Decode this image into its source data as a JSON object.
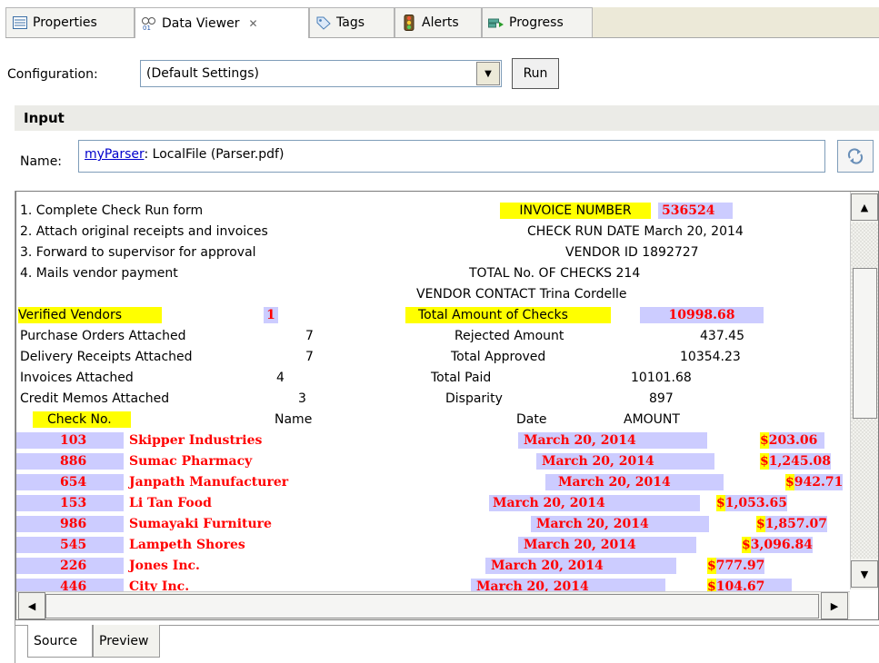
{
  "tabs": [
    {
      "label": "Properties",
      "icon": "properties-icon"
    },
    {
      "label": "Data Viewer",
      "icon": "data-viewer-icon",
      "active": true,
      "close": "✕"
    },
    {
      "label": "Tags",
      "icon": "tag-icon"
    },
    {
      "label": "Alerts",
      "icon": "alerts-icon"
    },
    {
      "label": "Progress",
      "icon": "progress-icon"
    }
  ],
  "config": {
    "label": "Configuration:",
    "value": "(Default Settings)",
    "run_label": "Run"
  },
  "input": {
    "header": "Input",
    "name_label": "Name:",
    "link": "myParser",
    "source": ": LocalFile (Parser.pdf)"
  },
  "document": {
    "instructions": [
      "1. Complete Check Run form",
      "2. Attach original receipts and invoices",
      "3. Forward to supervisor for approval",
      "4. Mails vendor payment"
    ],
    "invoice_number_label": "INVOICE NUMBER",
    "invoice_number": "536524",
    "check_run_date": "CHECK RUN DATE  March 20, 2014",
    "vendor_id": "VENDOR ID 1892727",
    "total_checks": "TOTAL No. OF CHECKS  214",
    "vendor_contact": "VENDOR CONTACT  Trina Cordelle",
    "left_stats": [
      {
        "label": "Verified Vendors",
        "value": "1"
      },
      {
        "label": "Purchase Orders Attached",
        "value": "7"
      },
      {
        "label": "Delivery Receipts Attached",
        "value": "7"
      },
      {
        "label": "Invoices Attached",
        "value": "4"
      },
      {
        "label": "Credit Memos Attached",
        "value": "3"
      }
    ],
    "right_stats": [
      {
        "label": "Total Amount of Checks",
        "value": "10998.68"
      },
      {
        "label": "Rejected Amount",
        "value": "437.45"
      },
      {
        "label": "Total Approved",
        "value": "10354.23"
      },
      {
        "label": "Total Paid",
        "value": "10101.68"
      },
      {
        "label": "Disparity",
        "value": "897"
      }
    ],
    "table_headers": {
      "check_no": "Check No.",
      "name": "Name",
      "date": "Date",
      "amount": "AMOUNT"
    },
    "rows": [
      {
        "check_no": "103",
        "name": "Skipper Industries",
        "date": "March 20, 2014",
        "amount": "203.06"
      },
      {
        "check_no": "886",
        "name": "Sumac Pharmacy",
        "date": "March 20, 2014",
        "amount": "1,245.08"
      },
      {
        "check_no": "654",
        "name": "Janpath Manufacturer",
        "date": "March 20, 2014",
        "amount": "942.71"
      },
      {
        "check_no": "153",
        "name": "Li Tan Food",
        "date": "March 20, 2014",
        "amount": "1,053.65"
      },
      {
        "check_no": "986",
        "name": "Sumayaki Furniture",
        "date": "March 20, 2014",
        "amount": "1,857.07"
      },
      {
        "check_no": "545",
        "name": "Lampeth Shores",
        "date": "March 20, 2014",
        "amount": "3,096.84"
      },
      {
        "check_no": "226",
        "name": "Jones Inc.",
        "date": "March 20, 2014",
        "amount": "777.97"
      },
      {
        "check_no": "446",
        "name": "City Inc.",
        "date": "March 20, 2014",
        "amount": "104.67"
      }
    ]
  },
  "bottom_tabs": [
    "Source",
    "Preview"
  ],
  "colors": {
    "highlight": "#ffff00",
    "parsed": "#ccccff",
    "parsed_text": "#ff0000"
  }
}
